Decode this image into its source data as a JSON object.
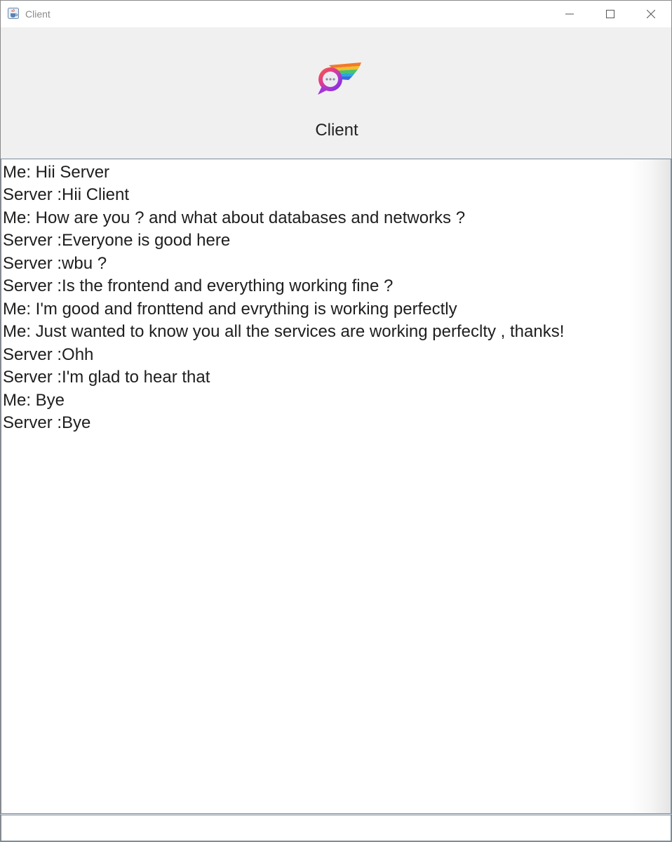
{
  "window": {
    "title": "Client",
    "icon": "java-cup-icon",
    "controls": {
      "minimize": "minimize-icon",
      "maximize": "maximize-icon",
      "close": "close-icon"
    }
  },
  "header": {
    "logo": "chat-bubble-wing-logo",
    "title": "Client"
  },
  "chat": {
    "messages": [
      "Me: Hii Server",
      "Server :Hii Client",
      "Me: How are you ? and what about databases and networks ?",
      "Server :Everyone is good here",
      "Server :wbu ?",
      "Server :Is the frontend and everything working fine ?",
      "Me: I'm good and fronttend and evrything is working perfectly",
      "Me: Just wanted to know you all the services are working perfeclty , thanks!",
      "Server :Ohh",
      "Server :I'm glad to hear that",
      "Me: Bye",
      "Server :Bye"
    ]
  },
  "input": {
    "value": "",
    "placeholder": ""
  },
  "colors": {
    "titlebar_bg": "#ffffff",
    "panel_bg": "#f0f0f0",
    "chat_bg": "#ffffff",
    "text": "#1e1e1e",
    "border": "#7a8a99"
  }
}
